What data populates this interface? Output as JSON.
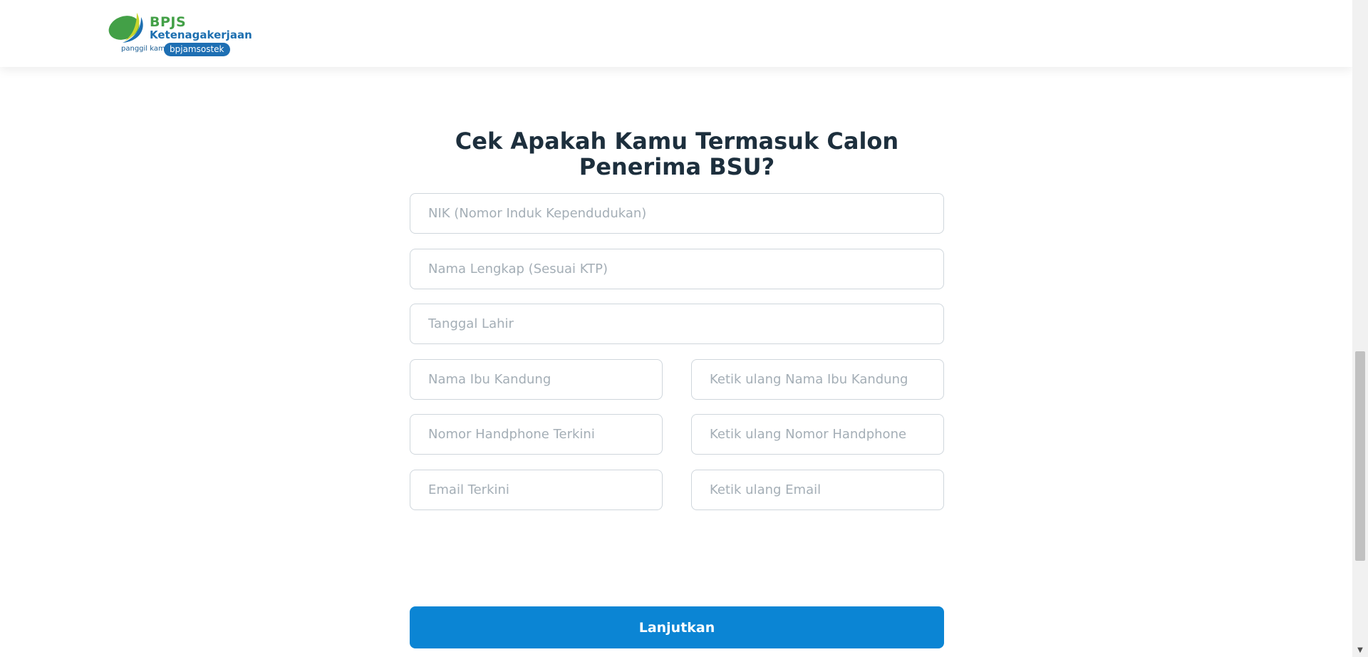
{
  "header": {
    "logo": {
      "line1": "BPJS",
      "line2": "Ketenagakerjaan",
      "tagline": "panggil kami",
      "badge": "bpjamsostek"
    }
  },
  "form": {
    "title": "Cek Apakah Kamu Termasuk Calon Penerima BSU?",
    "fields": {
      "nik": {
        "value": "",
        "placeholder": "NIK (Nomor Induk Kependudukan)"
      },
      "nama": {
        "value": "",
        "placeholder": "Nama Lengkap (Sesuai KTP)"
      },
      "tanggal_lahir": {
        "value": "",
        "placeholder": "Tanggal Lahir"
      },
      "ibu": {
        "value": "",
        "placeholder": "Nama Ibu Kandung"
      },
      "ibu_ulang": {
        "value": "",
        "placeholder": "Ketik ulang Nama Ibu Kandung"
      },
      "hp": {
        "value": "",
        "placeholder": "Nomor Handphone Terkini"
      },
      "hp_ulang": {
        "value": "",
        "placeholder": "Ketik ulang Nomor Handphone"
      },
      "email": {
        "value": "",
        "placeholder": "Email Terkini"
      },
      "email_ulang": {
        "value": "",
        "placeholder": "Ketik ulang Email"
      }
    },
    "submit_label": "Lanjutkan"
  },
  "colors": {
    "primary_button": "#0b85d4",
    "title_text": "#1d2f3d",
    "logo_green": "#43a047",
    "logo_blue": "#1d6fb0"
  }
}
